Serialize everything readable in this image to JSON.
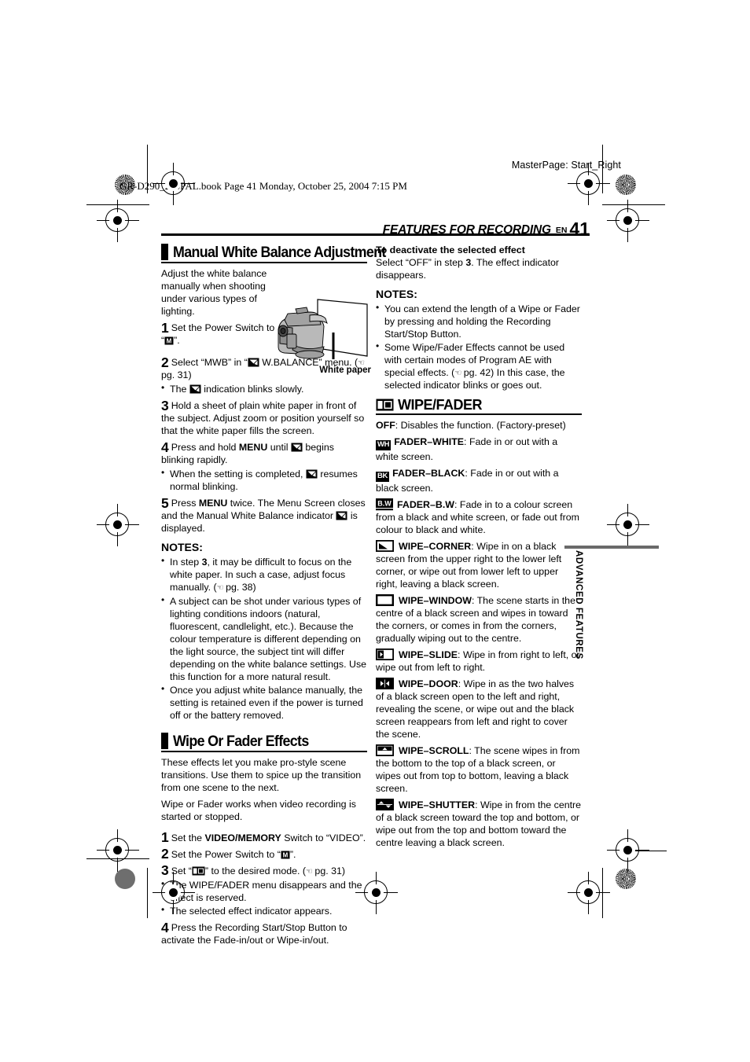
{
  "page": {
    "masterpage": "MasterPage: Start_Right",
    "bookline": "GR-D290_270PAL.book  Page 41  Monday, October 25, 2004  7:15 PM",
    "running_head": "FEATURES FOR RECORDING",
    "lang_code": "EN",
    "page_number": "41",
    "side_tab": "ADVANCED FEATURES"
  },
  "left": {
    "section1_title": "Manual White Balance Adjustment",
    "intro": "Adjust the white balance manually when shooting under various types of lighting.",
    "figure_caption": "White paper",
    "step1_num": "1",
    "step1_text_a": "Set the Power Switch to “",
    "step1_text_b": "”.",
    "step2_num": "2",
    "step2_text_a": "Select “MWB” in “",
    "step2_text_b": " W.BALANCE” menu. (",
    "step2_pg": " pg. 31)",
    "step2_bullet_a": "The ",
    "step2_bullet_b": " indication blinks slowly.",
    "step3_num": "3",
    "step3_text": "Hold a sheet of plain white paper in front of the subject. Adjust zoom or position yourself so that the white paper fills the screen.",
    "step4_num": "4",
    "step4_text_a": "Press and hold ",
    "step4_menu": "MENU",
    "step4_text_b": " until ",
    "step4_text_c": " begins blinking rapidly.",
    "step4_bullet_a": "When the setting is completed, ",
    "step4_bullet_b": " resumes normal blinking.",
    "step5_num": "5",
    "step5_text_a": "Press ",
    "step5_menu": "MENU",
    "step5_text_b": " twice. The Menu Screen closes and the Manual White Balance indicator ",
    "step5_text_c": " is displayed.",
    "notes_label": "NOTES:",
    "note1_a": "In step ",
    "note1_b": "3",
    "note1_c": ", it may be difficult to focus on the white paper. In such a case, adjust focus manually. (",
    "note1_pg": " pg. 38)",
    "note2": "A subject can be shot under various types of lighting conditions indoors (natural, fluorescent, candlelight, etc.). Because the colour temperature is different depending on the light source, the subject tint will differ depending on the white balance settings. Use this function for a more natural result.",
    "note3": "Once you adjust white balance manually, the setting is retained even if the power is turned off or the battery removed.",
    "section2_title": "Wipe Or Fader Effects",
    "s2_intro1": "These effects let you make pro-style scene transitions. Use them to spice up the transition from one scene to the next.",
    "s2_intro2": "Wipe or Fader works when video recording is started or stopped.",
    "s2_step1_num": "1",
    "s2_step1_a": "Set the ",
    "s2_step1_bold": "VIDEO/MEMORY",
    "s2_step1_b": " Switch to “VIDEO”.",
    "s2_step2_num": "2",
    "s2_step2_a": "Set the Power Switch to “",
    "s2_step2_b": "”.",
    "s2_step3_num": "3",
    "s2_step3_a": "Set “",
    "s2_step3_b": "” to the desired mode. (",
    "s2_step3_pg": " pg. 31)",
    "s2_bullet1": "The WIPE/FADER menu disappears and the effect is reserved.",
    "s2_bullet2": "The selected effect indicator appears.",
    "s2_step4_num": "4",
    "s2_step4": "Press the Recording Start/Stop Button to activate the Fade-in/out or Wipe-in/out."
  },
  "right": {
    "deactivate_head": "To deactivate the selected effect",
    "deactivate_a": "Select “OFF” in step ",
    "deactivate_b": "3",
    "deactivate_c": ". The effect indicator disappears.",
    "notes_label": "NOTES:",
    "note1": "You can extend the length of a Wipe or Fader by pressing and holding the Recording Start/Stop Button.",
    "note2_a": "Some Wipe/Fader Effects cannot be used with certain modes of Program AE with special effects. (",
    "note2_pg": " pg. 42)",
    "note2_b": " In this case, the selected indicator blinks or goes out.",
    "wipefader_title": "WIPE/FADER",
    "entries": [
      {
        "icon": "none",
        "icon_label": "",
        "name": "OFF",
        "sep": ": ",
        "desc": "Disables the function. (Factory-preset)"
      },
      {
        "icon": "box-text",
        "icon_label": "WH",
        "name": "FADER–WHITE",
        "sep": ": ",
        "desc": "Fade in or out with a white screen."
      },
      {
        "icon": "box-text",
        "icon_label": "BK",
        "name": "FADER–BLACK",
        "sep": ": ",
        "desc": "Fade in or out with a black screen."
      },
      {
        "icon": "box-text-underline",
        "icon_label": "B.W",
        "name": "FADER–B.W",
        "sep": ": ",
        "desc": "Fade in to a colour screen from a black and white screen, or fade out from colour to black and white."
      },
      {
        "icon": "wipe-corner-icon",
        "icon_label": "",
        "name": "WIPE–CORNER",
        "sep": ": ",
        "desc": "Wipe in on a black screen from the upper right to the lower left corner, or wipe out from lower left to upper right, leaving a black screen."
      },
      {
        "icon": "wipe-window-icon",
        "icon_label": "",
        "name": "WIPE–WINDOW",
        "sep": ": ",
        "desc": "The scene starts in the centre of a black screen and wipes in toward the corners, or comes in from the corners, gradually wiping out to the centre."
      },
      {
        "icon": "wipe-slide-icon",
        "icon_label": "",
        "name": "WIPE–SLIDE",
        "sep": ": ",
        "desc": "Wipe in from right to left, or wipe out from left to right."
      },
      {
        "icon": "wipe-door-icon",
        "icon_label": "",
        "name": "WIPE–DOOR",
        "sep": ": ",
        "desc": "Wipe in as the two halves of a black screen open to the left and right, revealing the scene, or wipe out and the black screen reappears from left and right to cover the scene."
      },
      {
        "icon": "wipe-scroll-icon",
        "icon_label": "",
        "name": "WIPE–SCROLL",
        "sep": ": ",
        "desc": "The scene wipes in from the bottom to the top of a black screen, or wipes out from top to bottom, leaving a black screen."
      },
      {
        "icon": "wipe-shutter-icon",
        "icon_label": "",
        "name": "WIPE–SHUTTER",
        "sep": ": ",
        "desc": "Wipe in from the centre of a black screen toward the top and bottom, or wipe out from the top and bottom toward the centre leaving a black screen."
      }
    ]
  }
}
